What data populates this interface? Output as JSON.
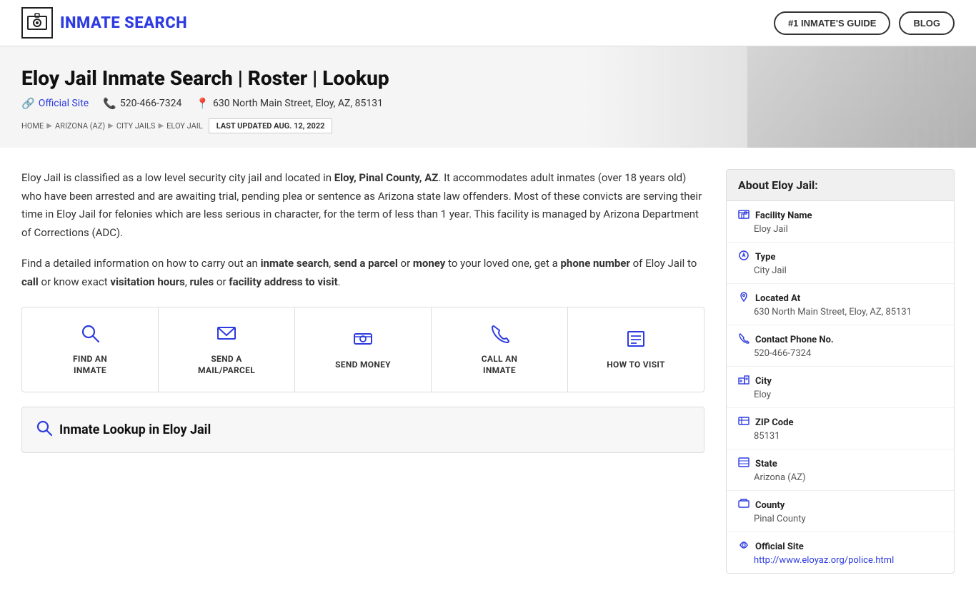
{
  "header": {
    "logo_icon": "🔒",
    "site_title": "INMATE SEARCH",
    "nav": {
      "guide_btn": "#1 INMATE'S GUIDE",
      "blog_btn": "BLOG"
    }
  },
  "hero": {
    "page_title": "Eloy Jail Inmate Search | Roster | Lookup",
    "official_site_label": "Official Site",
    "phone": "520-466-7324",
    "address": "630 North Main Street, Eloy, AZ, 85131",
    "breadcrumbs": [
      "HOME",
      "ARIZONA (AZ)",
      "CITY JAILS",
      "ELOY JAIL"
    ],
    "last_updated": "LAST UPDATED AUG. 12, 2022"
  },
  "body": {
    "paragraph1_start": "Eloy Jail is classified as a low level security city jail and located in ",
    "paragraph1_bold": "Eloy, Pinal County, AZ",
    "paragraph1_end": ". It accommodates adult inmates (over 18 years old) who have been arrested and are awaiting trial, pending plea or sentence as Arizona state law offenders. Most of these convicts are serving their time in Eloy Jail for felonies which are less serious in character, for the term of less than 1 year. This facility is managed by Arizona Department of Corrections (ADC).",
    "paragraph2_start": "Find a detailed information on how to carry out an ",
    "paragraph2_bold1": "inmate search",
    "paragraph2_mid1": ", ",
    "paragraph2_bold2": "send a parcel",
    "paragraph2_mid2": " or ",
    "paragraph2_bold3": "money",
    "paragraph2_mid3": " to your loved one, get a ",
    "paragraph2_bold4": "phone number",
    "paragraph2_mid4": " of Eloy Jail to ",
    "paragraph2_bold5": "call",
    "paragraph2_mid5": " or know exact ",
    "paragraph2_bold6": "visitation hours",
    "paragraph2_mid6": ", ",
    "paragraph2_bold7": "rules",
    "paragraph2_mid7": " or ",
    "paragraph2_bold8": "facility address to visit",
    "paragraph2_end": "."
  },
  "action_cards": [
    {
      "id": "find-inmate",
      "icon": "🔍",
      "label": "FIND AN\nINMATE"
    },
    {
      "id": "send-mail",
      "icon": "✉",
      "label": "SEND A\nMAIL/PARCEL"
    },
    {
      "id": "send-money",
      "icon": "💳",
      "label": "SEND MONEY"
    },
    {
      "id": "call-inmate",
      "icon": "📞",
      "label": "CALL AN\nINMATE"
    },
    {
      "id": "how-to-visit",
      "icon": "📋",
      "label": "HOW TO VISIT"
    }
  ],
  "lookup_section": {
    "title": "Inmate Lookup in Eloy Jail"
  },
  "sidebar": {
    "title": "About Eloy Jail:",
    "rows": [
      {
        "icon": "🏢",
        "label": "Facility Name",
        "value": "Eloy Jail"
      },
      {
        "icon": "🔑",
        "label": "Type",
        "value": "City Jail"
      },
      {
        "icon": "📍",
        "label": "Located At",
        "value": "630 North Main Street, Eloy, AZ, 85131"
      },
      {
        "icon": "📞",
        "label": "Contact Phone No.",
        "value": "520-466-7324"
      },
      {
        "icon": "🏙",
        "label": "City",
        "value": "Eloy"
      },
      {
        "icon": "✉",
        "label": "ZIP Code",
        "value": "85131"
      },
      {
        "icon": "🗺",
        "label": "State",
        "value": "Arizona (AZ)"
      },
      {
        "icon": "🏛",
        "label": "County",
        "value": "Pinal County"
      },
      {
        "icon": "🔗",
        "label": "Official Site",
        "value": "http://www.eloyaz.org/police.html",
        "is_link": true
      }
    ]
  }
}
